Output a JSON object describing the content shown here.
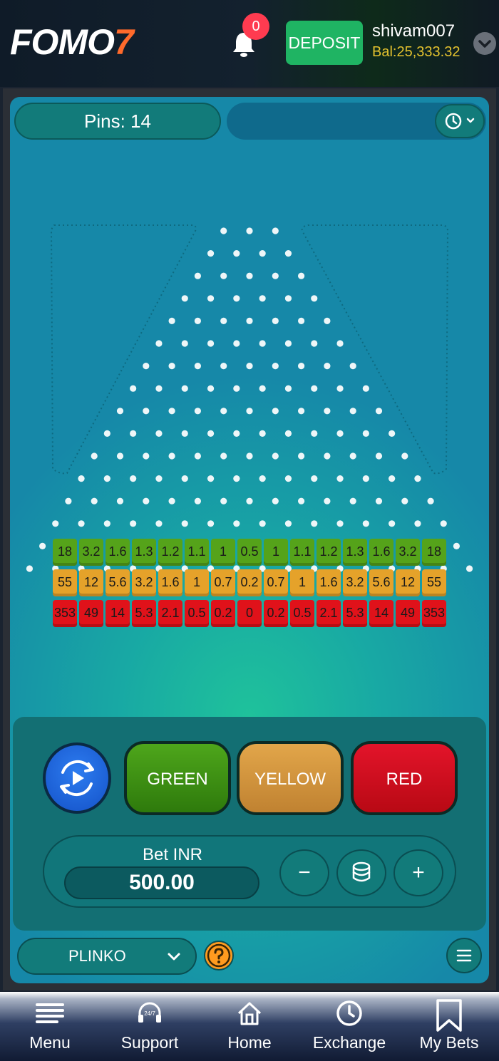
{
  "header": {
    "logo_main": "FOMO",
    "logo_accent": "7",
    "notification_count": "0",
    "deposit_label": "DEPOSIT",
    "username": "shivam007",
    "balance": "Bal:25,333.32",
    "bell_icon": "bell-icon",
    "chevron_icon": "chevron-down-icon"
  },
  "game": {
    "pins_label": "Pins: 14",
    "pins": 14,
    "history_icon": "history-icon",
    "multipliers": {
      "green": [
        "18",
        "3.2",
        "1.6",
        "1.3",
        "1.2",
        "1.1",
        "1",
        "0.5",
        "1",
        "1.1",
        "1.2",
        "1.3",
        "1.6",
        "3.2",
        "18"
      ],
      "yellow": [
        "55",
        "12",
        "5.6",
        "3.2",
        "1.6",
        "1",
        "0.7",
        "0.2",
        "0.7",
        "1",
        "1.6",
        "3.2",
        "5.6",
        "12",
        "55"
      ],
      "red": [
        "353",
        "49",
        "14",
        "5.3",
        "2.1",
        "0.5",
        "0.2",
        "0",
        "0.2",
        "0.5",
        "2.1",
        "5.3",
        "14",
        "49",
        "353"
      ]
    },
    "colors": {
      "green": "#55a31a",
      "yellow": "#e5a22a",
      "red": "#e0121a"
    }
  },
  "controls": {
    "auto_icon": "auto-play-icon",
    "green_label": "GREEN",
    "yellow_label": "YELLOW",
    "red_label": "RED",
    "bet_label": "Bet INR",
    "bet_value": "500.00",
    "minus_label": "−",
    "plus_label": "+",
    "coins_icon": "coins-stack-icon"
  },
  "footer_bar": {
    "game_name": "PLINKO",
    "help_icon": "question-icon",
    "menu_icon": "hamburger-icon"
  },
  "nav": {
    "items": [
      {
        "label": "Menu",
        "icon": "menu-icon"
      },
      {
        "label": "Support",
        "icon": "support-headset-icon"
      },
      {
        "label": "Home",
        "icon": "home-icon"
      },
      {
        "label": "Exchange",
        "icon": "clock-icon"
      },
      {
        "label": "My Bets",
        "icon": "bookmark-icon"
      }
    ]
  }
}
